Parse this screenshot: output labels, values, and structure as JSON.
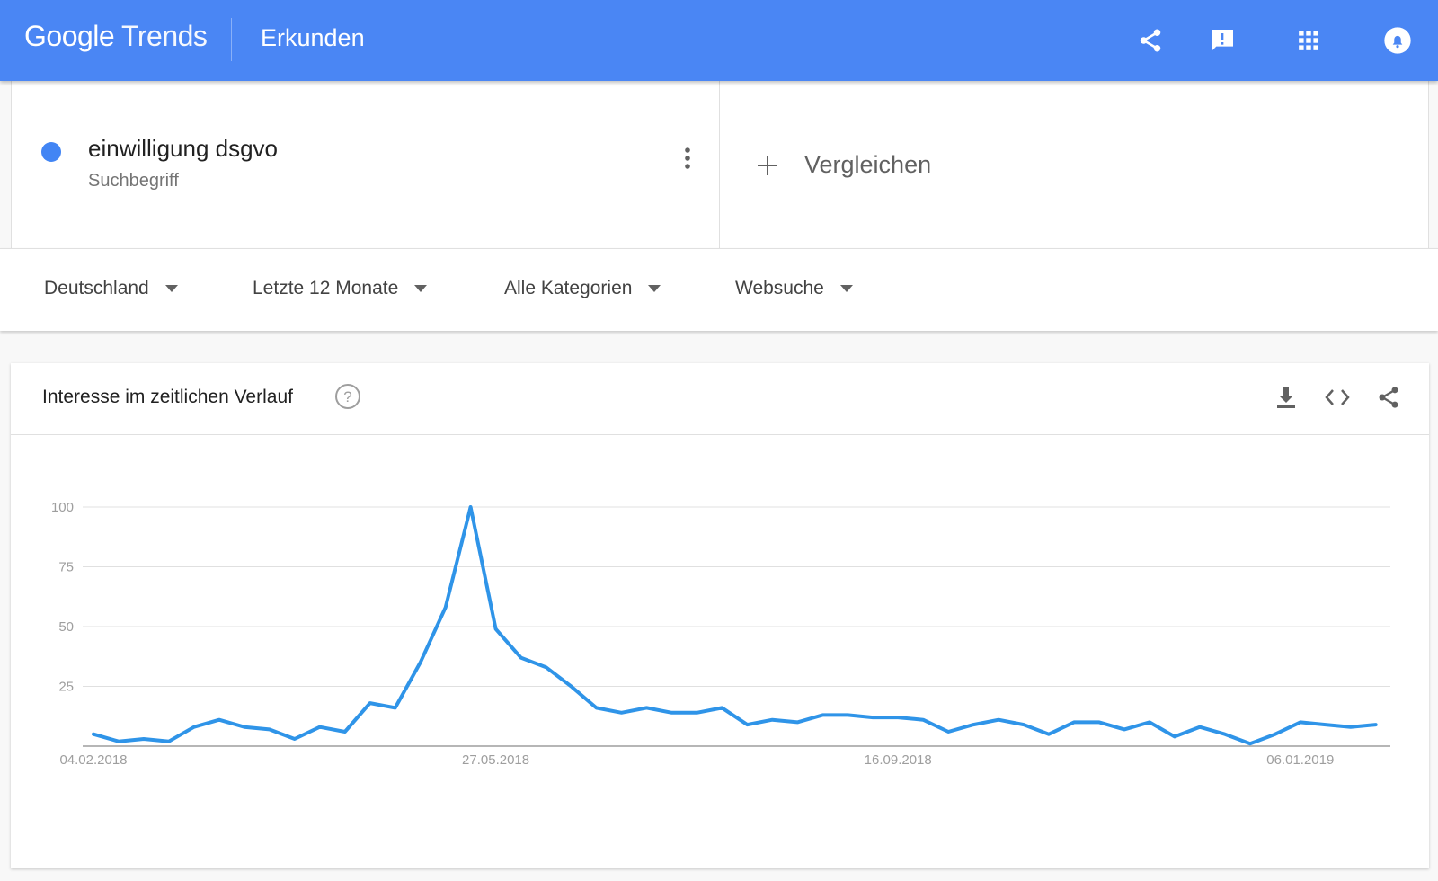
{
  "header": {
    "logo_google": "Google",
    "logo_trends": "Trends",
    "section": "Erkunden",
    "icons": [
      "share-icon",
      "feedback-icon",
      "apps-grid-icon",
      "notifications-icon"
    ],
    "color": "#4a86f4"
  },
  "term": {
    "name": "einwilligung dsgvo",
    "type": "Suchbegriff",
    "color": "#4285f4"
  },
  "compare": {
    "label": "Vergleichen"
  },
  "filters": {
    "region": "Deutschland",
    "period": "Letzte 12 Monate",
    "category": "Alle Kategorien",
    "search_type": "Websuche"
  },
  "card": {
    "title": "Interesse im zeitlichen Verlauf",
    "icons": [
      "help-icon",
      "download-icon",
      "embed-code-icon",
      "share-icon"
    ]
  },
  "chart_data": {
    "type": "line",
    "title": "",
    "xlabel": "",
    "ylabel": "",
    "ylim": [
      0,
      100
    ],
    "yticks": [
      25,
      50,
      75,
      100
    ],
    "x_tick_labels": [
      "04.02.2018",
      "27.05.2018",
      "16.09.2018",
      "06.01.2019"
    ],
    "x_tick_indices": [
      0,
      16,
      32,
      48
    ],
    "grid": true,
    "legend": "none",
    "series": [
      {
        "color": "#2f94e8",
        "values": [
          5,
          2,
          3,
          2,
          8,
          11,
          8,
          7,
          3,
          8,
          6,
          18,
          16,
          35,
          58,
          100,
          49,
          37,
          33,
          25,
          16,
          14,
          16,
          14,
          14,
          16,
          9,
          11,
          10,
          13,
          13,
          12,
          12,
          11,
          6,
          9,
          11,
          9,
          5,
          10,
          10,
          7,
          10,
          4,
          8,
          5,
          1,
          5,
          10,
          9,
          8,
          9
        ]
      }
    ]
  }
}
